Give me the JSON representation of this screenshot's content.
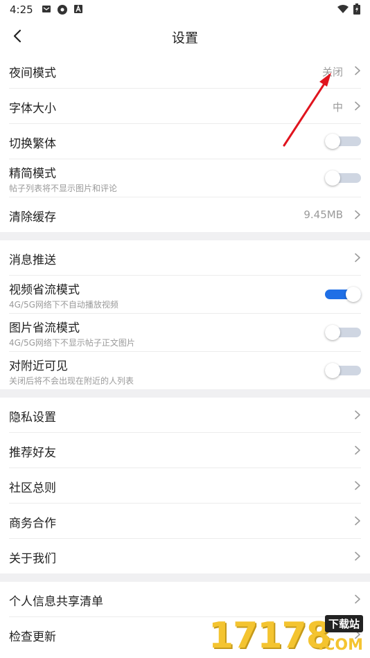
{
  "status": {
    "time": "4:25"
  },
  "nav": {
    "title": "设置"
  },
  "sections": [
    {
      "items": [
        {
          "label": "夜间模式",
          "value": "关闭",
          "control": "chevron"
        },
        {
          "label": "字体大小",
          "value": "中",
          "control": "chevron"
        },
        {
          "label": "切换繁体",
          "control": "toggle",
          "on": false
        },
        {
          "label": "精简模式",
          "sub": "帖子列表将不显示图片和评论",
          "control": "toggle",
          "on": false
        },
        {
          "label": "清除缓存",
          "value": "9.45MB",
          "control": "chevron"
        }
      ]
    },
    {
      "items": [
        {
          "label": "消息推送",
          "control": "chevron"
        },
        {
          "label": "视频省流模式",
          "sub": "4G/5G网络下不自动播放视频",
          "control": "toggle",
          "on": true
        },
        {
          "label": "图片省流模式",
          "sub": "4G/5G网络下不显示帖子正文图片",
          "control": "toggle",
          "on": false
        },
        {
          "label": "对附近可见",
          "sub": "关闭后将不会出现在附近的人列表",
          "control": "toggle",
          "on": false
        }
      ]
    },
    {
      "items": [
        {
          "label": "隐私设置",
          "control": "chevron"
        },
        {
          "label": "推荐好友",
          "control": "chevron"
        },
        {
          "label": "社区总则",
          "control": "chevron"
        },
        {
          "label": "商务合作",
          "control": "chevron"
        },
        {
          "label": "关于我们",
          "control": "chevron"
        }
      ]
    },
    {
      "items": [
        {
          "label": "个人信息共享清单",
          "control": "chevron"
        },
        {
          "label": "检查更新",
          "control": "chevron"
        }
      ]
    }
  ],
  "watermark": {
    "number": "17178",
    "badge": "下载站",
    "suffix": ".COM"
  },
  "colors": {
    "accent": "#1f6fe6",
    "toggle_off": "#cfd6e2",
    "annotation": "#e0141e"
  }
}
